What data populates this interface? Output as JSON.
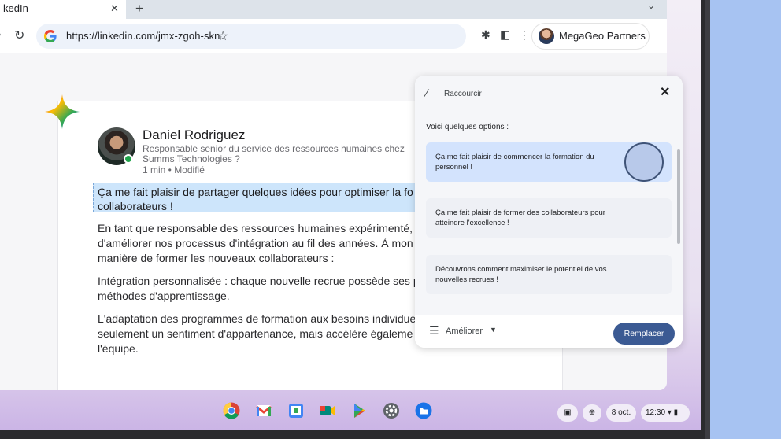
{
  "browser": {
    "tab_title": "kedIn",
    "tab_close": "✕",
    "new_tab": "+",
    "tab_menu": "⌄",
    "url": "https://linkedin.com/jmx-zgoh-skn",
    "profile_name": "MegaGeo Partners"
  },
  "post": {
    "author": "Daniel Rodriguez",
    "headline": "Responsable senior du service des ressources humaines chez Summs Technologies ?",
    "meta": "1 min • Modifié",
    "highlighted_line1": "Ça me fait plaisir de partager quelques idées pour optimiser la fo",
    "highlighted_line2": "collaborateurs !",
    "para1_line1": "En tant que responsable des ressources humaines expérimenté, j",
    "para1_line2": "d'améliorer nos processus d'intégration au fil des années. À mon a",
    "para1_line3": "manière de former les nouveaux collaborateurs :",
    "para2_line1": "Intégration personnalisée : chaque nouvelle recrue possède ses p",
    "para2_line2": "méthodes d'apprentissage.",
    "para3_line1": "L'adaptation des programmes de formation aux besoins individue",
    "para3_line2": "seulement un sentiment d'appartenance, mais accélère égaleme",
    "para3_line3": "l'équipe."
  },
  "popup": {
    "title": "Raccourcir",
    "close": "✕",
    "intro": "Voici quelques options :",
    "options": [
      "Ça me fait plaisir de commencer la formation du personnel !",
      "Ça me fait plaisir de former des collaborateurs pour atteindre l'excellence !",
      "Découvrons comment maximiser le potentiel de vos nouvelles recrues !"
    ],
    "improve_label": "Améliorer",
    "replace_label": "Remplacer"
  },
  "shelf": {
    "date": "8 oct.",
    "time": "12:30",
    "apps": [
      "chrome-icon",
      "gmail-icon",
      "calendar-icon",
      "meet-icon",
      "play-store-icon",
      "settings-icon",
      "files-icon"
    ]
  }
}
